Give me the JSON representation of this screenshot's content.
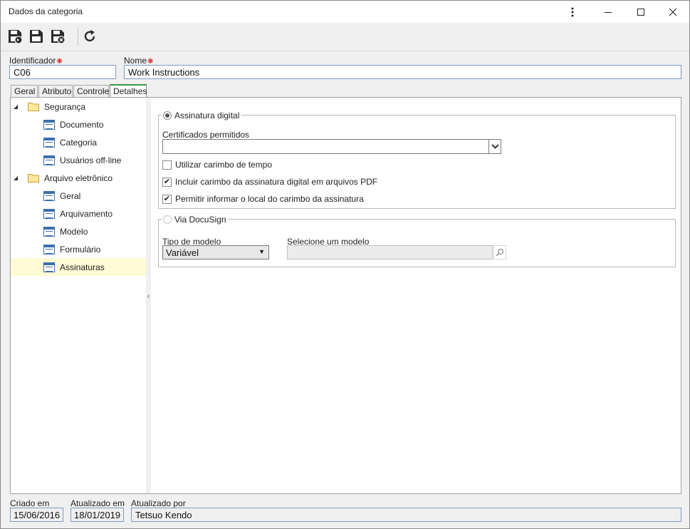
{
  "window": {
    "title": "Dados da categoria"
  },
  "header": {
    "identificador_label": "Identificador",
    "identificador_value": "C06",
    "nome_label": "Nome",
    "nome_value": "Work Instructions"
  },
  "tabs": [
    {
      "label": "Geral"
    },
    {
      "label": "Atributo"
    },
    {
      "label": "Controle"
    },
    {
      "label": "Detalhes"
    }
  ],
  "tree": {
    "groups": [
      {
        "label": "Segurança",
        "items": [
          "Documento",
          "Categoria",
          "Usuários off-line"
        ]
      },
      {
        "label": "Arquivo eletrônico",
        "items": [
          "Geral",
          "Arquivamento",
          "Modelo",
          "Formulário",
          "Assinaturas"
        ]
      }
    ],
    "selected": "Assinaturas"
  },
  "assinatura_digital": {
    "label": "Assinatura digital",
    "selected": true,
    "certificados_label": "Certificados permitidos",
    "certificados_value": "",
    "options": [
      {
        "label": "Utilizar carimbo de tempo",
        "checked": false
      },
      {
        "label": "Incluir carimbo da assinatura digital em arquivos PDF",
        "checked": true
      },
      {
        "label": "Permitir informar o local do carimbo da assinatura",
        "checked": true
      }
    ]
  },
  "docusign": {
    "label": "Via DocuSign",
    "selected": false,
    "tipo_label": "Tipo de modelo",
    "tipo_value": "Variável",
    "selecione_label": "Selecione um modelo",
    "selecione_value": ""
  },
  "footer": {
    "criado_label": "Criado em",
    "criado_value": "15/06/2016",
    "atualizado_label": "Atualizado em",
    "atualizado_value": "18/01/2019",
    "atualizado_por_label": "Atualizado por",
    "atualizado_por_value": "Tetsuo Kendo"
  },
  "colors": {
    "active_tab_accent": "#3a9a3a",
    "required_marker": "#d40000",
    "field_border": "#7a9cc7",
    "selected_row": "#fffbd6",
    "icon_blue": "#3b6fb0"
  },
  "icons": {
    "toolbar": [
      "save-and-new-icon",
      "save-icon",
      "save-and-close-icon",
      "refresh-icon"
    ],
    "window": [
      "more-vert-icon",
      "minimize-icon",
      "maximize-icon",
      "close-icon"
    ]
  }
}
